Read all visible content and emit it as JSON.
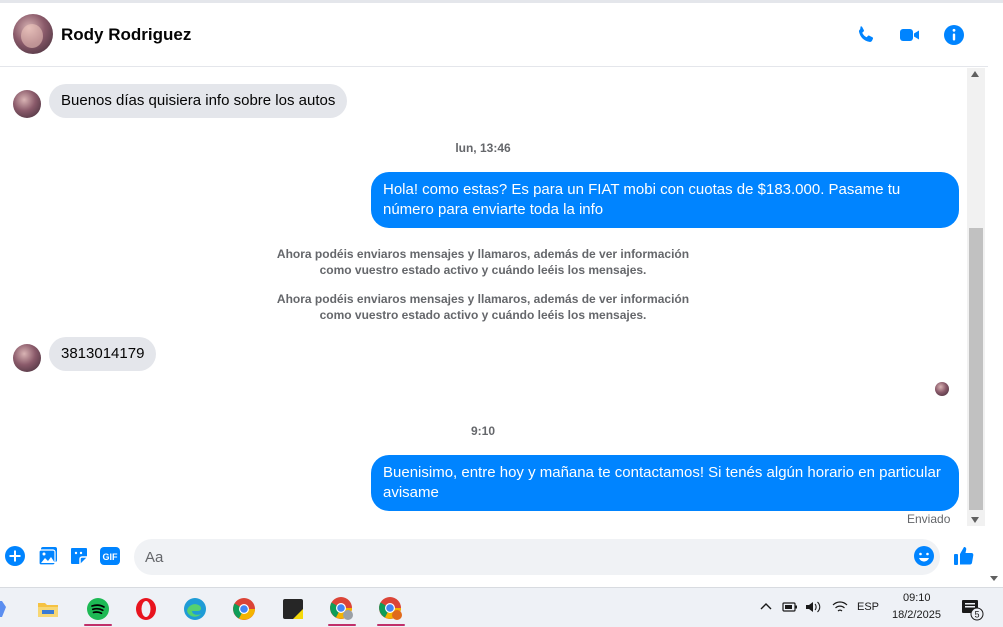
{
  "header": {
    "contact_name": "Rody Rodriguez",
    "icons": [
      "phone-icon",
      "video-call-icon",
      "info-icon"
    ]
  },
  "messages": [
    {
      "type": "incoming",
      "text": "Buenos días quisiera info sobre los autos"
    },
    {
      "type": "timestamp",
      "text": "lun, 13:46"
    },
    {
      "type": "outgoing",
      "text": "Hola! como estas? Es para un FIAT mobi con cuotas de $183.000. Pasame tu número para enviarte toda la info"
    },
    {
      "type": "system",
      "text": "Ahora podéis enviaros mensajes y llamaros, además de ver información como vuestro estado activo y cuándo leéis los mensajes."
    },
    {
      "type": "system",
      "text": "Ahora podéis enviaros mensajes y llamaros, además de ver información como vuestro estado activo y cuándo leéis los mensajes."
    },
    {
      "type": "incoming",
      "text": "3813014179"
    },
    {
      "type": "timestamp",
      "text": "9:10"
    },
    {
      "type": "outgoing",
      "text": "Buenisimo, entre hoy y mañana te contactamos! Si tenés algún horario en particular avisame"
    }
  ],
  "status": "Enviado",
  "composer": {
    "placeholder": "Aa",
    "icons": [
      "add-icon",
      "image-icon",
      "sticker-icon",
      "gif-icon",
      "emoji-icon",
      "like-icon"
    ],
    "gif_label": "GIF"
  },
  "colors": {
    "accent": "#0084ff",
    "incoming_bubble": "#e4e6eb",
    "muted_text": "#65676b"
  },
  "taskbar": {
    "apps": [
      "copilot-icon",
      "file-explorer-icon",
      "spotify-icon",
      "opera-icon",
      "edge-icon",
      "chrome-icon",
      "sticky-notes-icon",
      "chrome-profile-icon",
      "chrome-profile-2-icon"
    ],
    "language": "ESP",
    "time": "09:10",
    "date": "18/2/2025",
    "notification_count": "5"
  }
}
